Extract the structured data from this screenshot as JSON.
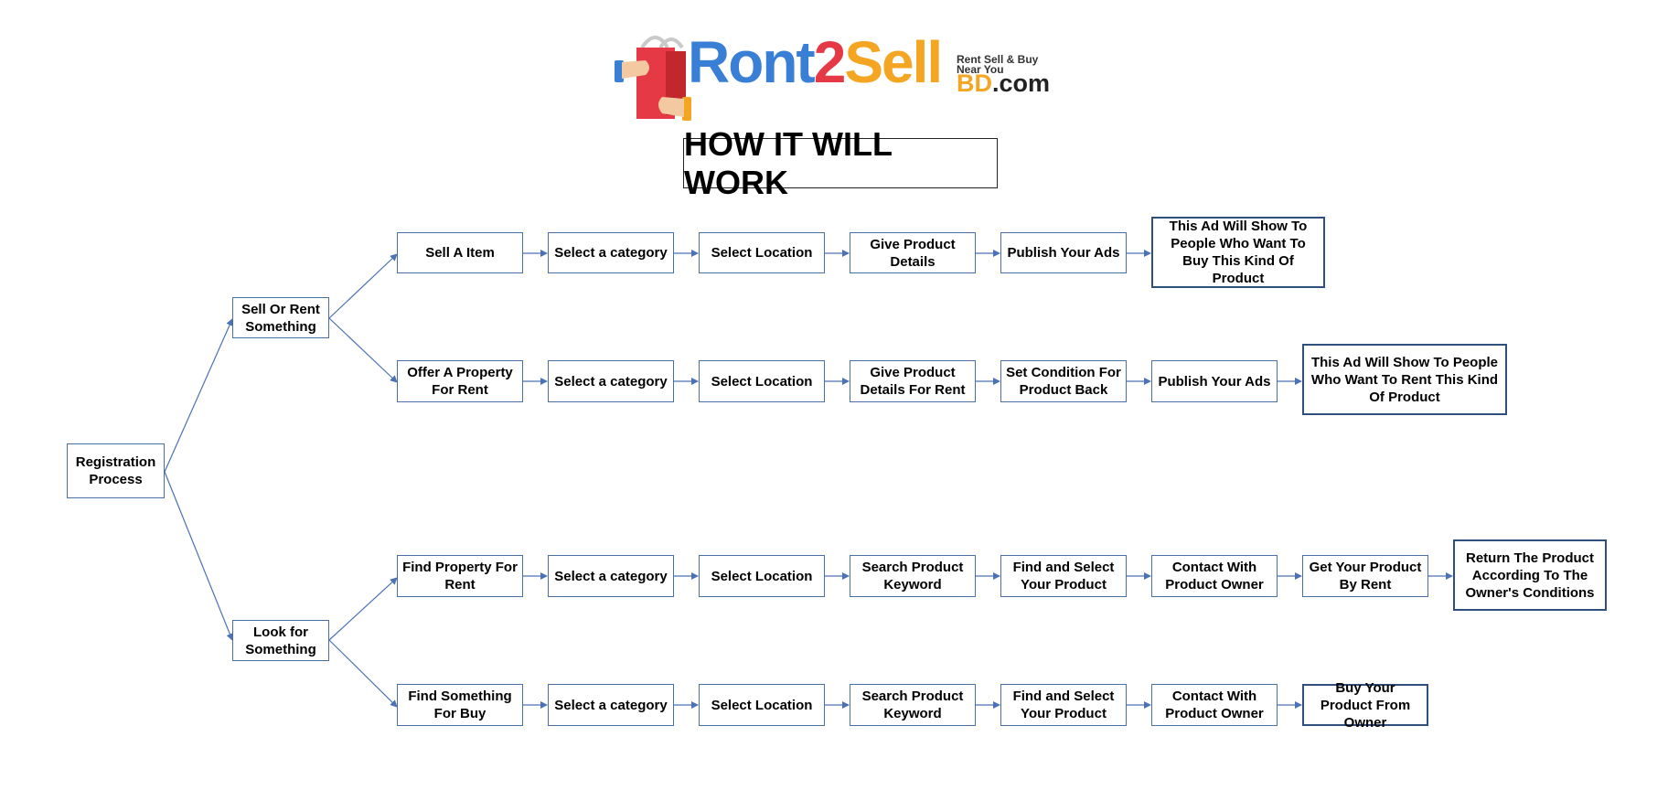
{
  "logo": {
    "part1": "R",
    "part2": "nt",
    "part3": "2",
    "part4": "Sell",
    "tagline_line1": "Rent Sell & Buy",
    "tagline_line2": "Near You",
    "domain_bd": "BD",
    "domain_com": ".com"
  },
  "title": "HOW IT WILL WORK",
  "root": "Registration Process",
  "branch_sell": "Sell Or Rent Something",
  "branch_look": "Look for Something",
  "row1": [
    "Sell A Item",
    "Select a category",
    "Select Location",
    "Give Product Details",
    "Publish Your Ads",
    "This Ad Will Show To People Who Want To Buy This Kind Of Product"
  ],
  "row2": [
    "Offer A Property For Rent",
    "Select a category",
    "Select Location",
    "Give Product Details For Rent",
    "Set Condition For Product Back",
    "Publish Your Ads",
    "This Ad Will Show To People Who Want To Rent This Kind Of Product"
  ],
  "row3": [
    "Find Property For Rent",
    "Select a category",
    "Select Location",
    "Search Product Keyword",
    "Find and Select Your Product",
    "Contact With Product Owner",
    "Get Your Product By Rent",
    "Return The Product According To The Owner's Conditions"
  ],
  "row4": [
    "Find Something For Buy",
    "Select a category",
    "Select Location",
    "Search Product Keyword",
    "Find and Select Your Product",
    "Contact With Product Owner",
    "Buy Your Product From Owner"
  ],
  "colors": {
    "arrow": "#4a72b5",
    "box_border": "#4a6fa5",
    "final_border": "#2f4f7f"
  }
}
